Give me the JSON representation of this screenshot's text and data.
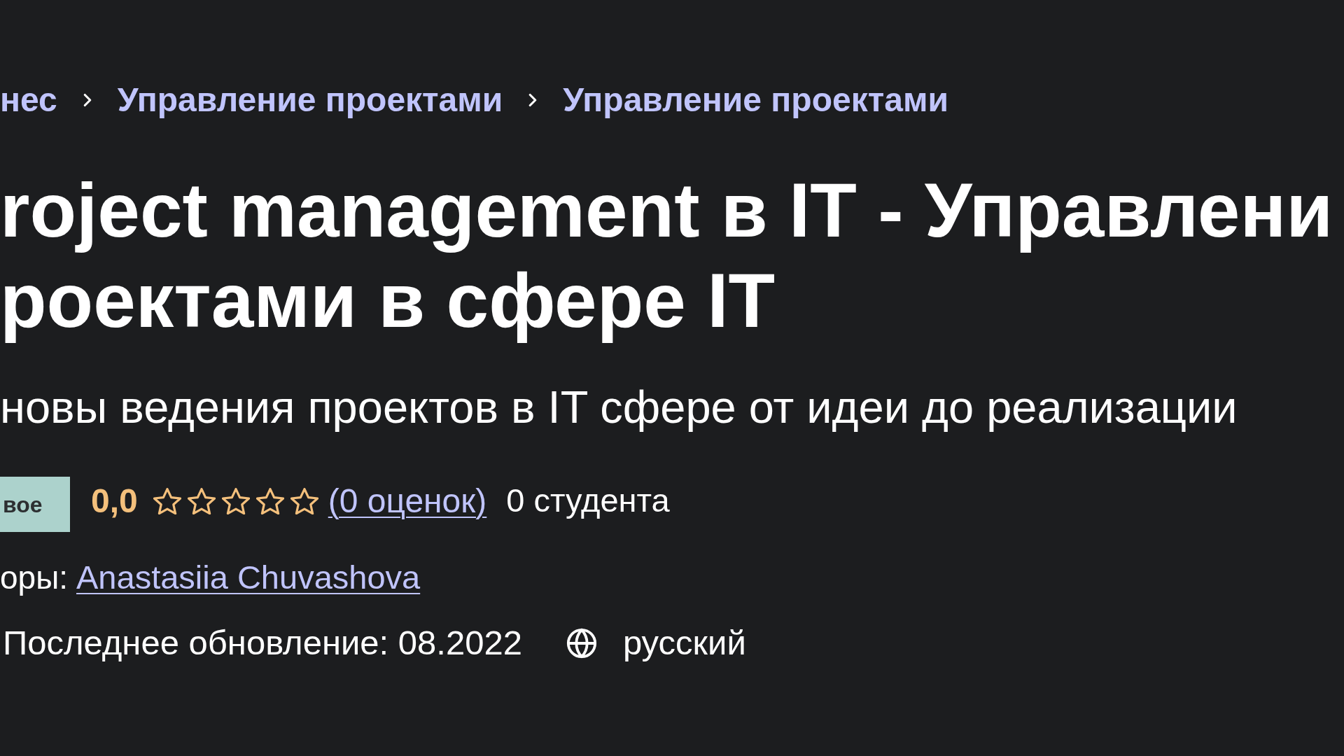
{
  "breadcrumbs": [
    {
      "label": "нес"
    },
    {
      "label": "Управление проектами"
    },
    {
      "label": "Управление проектами"
    }
  ],
  "title": {
    "lines": [
      "roject management в IT - Управлени",
      "роектами в сфере IT"
    ]
  },
  "subtitle": "новы ведения проектов в IT сфере от идеи до реализации",
  "badge": "вое",
  "rating": {
    "score": "0,0",
    "stars": 0,
    "reviews_link": "(0 оценок)",
    "students": "0 студента"
  },
  "authors": {
    "label": "оры:",
    "name": "Anastasiia Chuvashova"
  },
  "meta": {
    "updated": "Последнее обновление: 08.2022",
    "language": "русский"
  }
}
